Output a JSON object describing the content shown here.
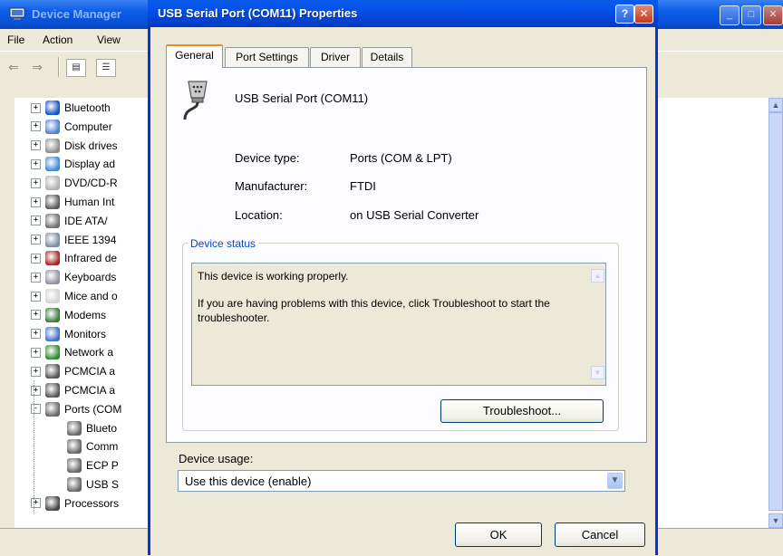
{
  "background_window": {
    "title": "Device Manager",
    "menu": [
      "File",
      "Action",
      "View"
    ],
    "tree": [
      {
        "label": "Bluetooth",
        "expander": "+",
        "icon": "bluetooth-icon"
      },
      {
        "label": "Computer",
        "expander": "+",
        "icon": "computer-icon"
      },
      {
        "label": "Disk drives",
        "expander": "+",
        "icon": "disk-drive-icon"
      },
      {
        "label": "Display ad",
        "expander": "+",
        "icon": "display-adapter-icon"
      },
      {
        "label": "DVD/CD-R",
        "expander": "+",
        "icon": "dvd-icon"
      },
      {
        "label": "Human Int",
        "expander": "+",
        "icon": "hid-icon"
      },
      {
        "label": "IDE ATA/",
        "expander": "+",
        "icon": "ide-icon"
      },
      {
        "label": "IEEE 1394",
        "expander": "+",
        "icon": "ieee1394-icon"
      },
      {
        "label": "Infrared de",
        "expander": "+",
        "icon": "infrared-icon"
      },
      {
        "label": "Keyboards",
        "expander": "+",
        "icon": "keyboard-icon"
      },
      {
        "label": "Mice and o",
        "expander": "+",
        "icon": "mouse-icon"
      },
      {
        "label": "Modems",
        "expander": "+",
        "icon": "modem-icon"
      },
      {
        "label": "Monitors",
        "expander": "+",
        "icon": "monitor-icon"
      },
      {
        "label": "Network a",
        "expander": "+",
        "icon": "network-icon"
      },
      {
        "label": "PCMCIA a",
        "expander": "+",
        "icon": "pcmcia-icon"
      },
      {
        "label": "PCMCIA a",
        "expander": "+",
        "icon": "pcmcia-icon"
      },
      {
        "label": "Ports (COM",
        "expander": "-",
        "icon": "port-icon"
      },
      {
        "label": "Blueto",
        "expander": "",
        "icon": "port-icon"
      },
      {
        "label": "Comm",
        "expander": "",
        "icon": "port-icon"
      },
      {
        "label": "ECP P",
        "expander": "",
        "icon": "port-icon"
      },
      {
        "label": "USB S",
        "expander": "",
        "icon": "port-icon"
      },
      {
        "label": "Processors",
        "expander": "+",
        "icon": "processor-icon"
      }
    ]
  },
  "dialog": {
    "title": "USB Serial Port (COM11) Properties",
    "help_glyph": "?",
    "close_glyph": "✕",
    "tabs": [
      "General",
      "Port Settings",
      "Driver",
      "Details"
    ],
    "active_tab": "General",
    "device_name": "USB Serial Port (COM11)",
    "props": {
      "type_label": "Device type:",
      "type_value": "Ports (COM & LPT)",
      "mfr_label": "Manufacturer:",
      "mfr_value": "FTDI",
      "loc_label": "Location:",
      "loc_value": "on USB Serial Converter"
    },
    "status": {
      "legend": "Device status",
      "line1": "This device is working properly.",
      "line2": "If you are having problems with this device, click Troubleshoot to start the troubleshooter."
    },
    "troubleshoot_label": "Troubleshoot...",
    "usage_label": "Device usage:",
    "usage_value": "Use this device (enable)",
    "ok_label": "OK",
    "cancel_label": "Cancel"
  },
  "colors": {
    "xp_title_blue": "#0453ed",
    "dialog_face": "#ece9d8",
    "groupbox_legend": "#0046d5",
    "active_tab_accent": "#e68b2c"
  }
}
